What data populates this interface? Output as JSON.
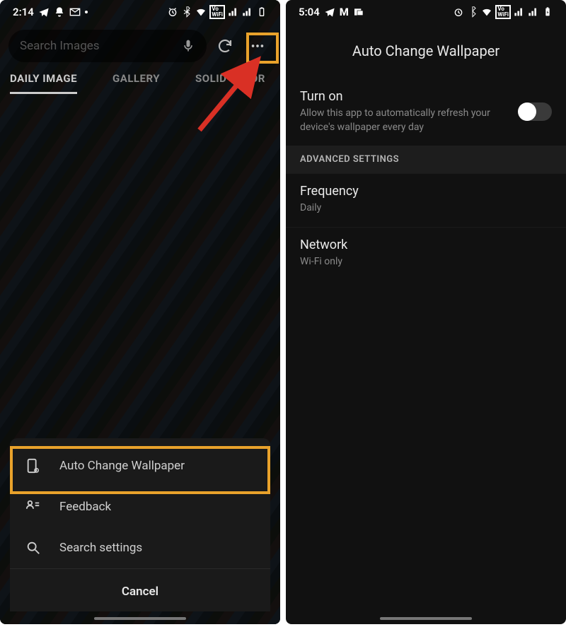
{
  "left": {
    "status": {
      "time": "2:14"
    },
    "search": {
      "placeholder": "Search Images"
    },
    "tabs": [
      "DAILY IMAGE",
      "GALLERY",
      "SOLID COLOR"
    ],
    "menu": {
      "items": [
        {
          "label": "Auto Change Wallpaper"
        },
        {
          "label": "Feedback"
        },
        {
          "label": "Search settings"
        }
      ],
      "cancel": "Cancel"
    }
  },
  "right": {
    "status": {
      "time": "5:04"
    },
    "title": "Auto Change Wallpaper",
    "turn_on": {
      "title": "Turn on",
      "subtitle": "Allow this app to automatically refresh your device's wallpaper every day",
      "enabled": false
    },
    "section_header": "ADVANCED SETTINGS",
    "frequency": {
      "title": "Frequency",
      "value": "Daily"
    },
    "network": {
      "title": "Network",
      "value": "Wi-Fi only"
    }
  },
  "annotations": {
    "arrow_color": "#d93025",
    "highlight_color": "#e9a22b"
  }
}
